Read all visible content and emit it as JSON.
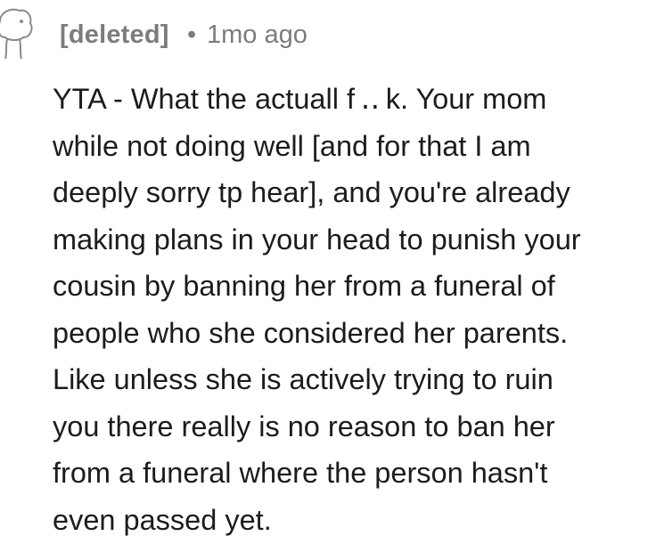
{
  "comment": {
    "author": "[deleted]",
    "separator": "•",
    "age": "1mo ago",
    "avatar_icon": "snoo-avatar-icon",
    "body": "YTA - What the actuall f ․․ k. Your mom\nwhile not doing well [and for that I am\ndeeply sorry tp hear], and you're already\nmaking plans in your head to punish your\ncousin by banning her from a funeral of\npeople who she considered her parents.\nLike unless she is actively trying to ruin\nyou there really is no reason to ban her\nfrom a funeral where the person hasn't\neven passed yet."
  },
  "colors": {
    "meta_text": "#7c7c7c",
    "body_text": "#1c1c1c",
    "background": "#ffffff"
  }
}
